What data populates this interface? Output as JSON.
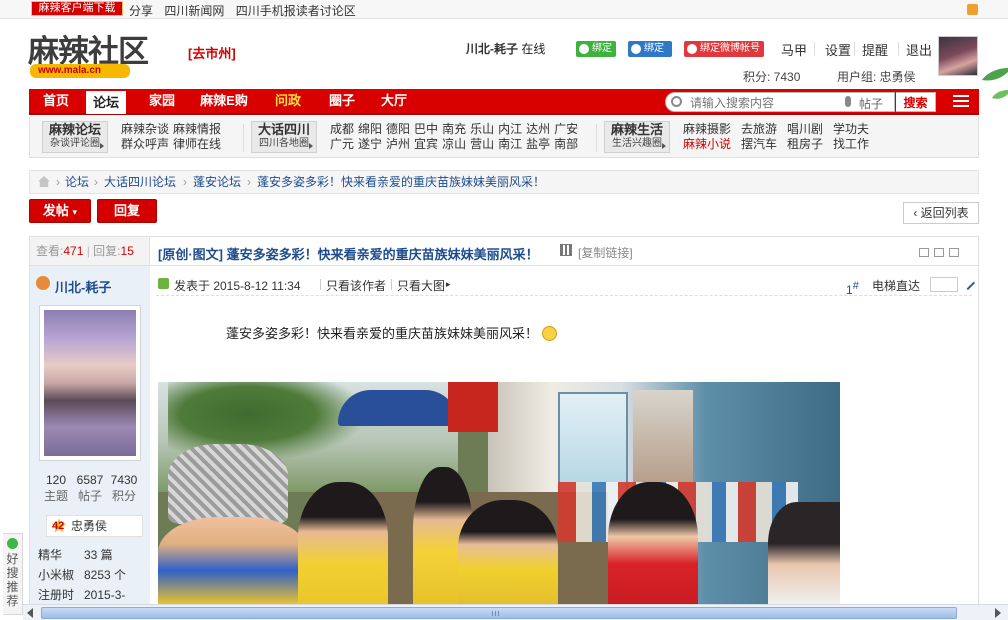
{
  "topbar": {
    "download_btn": "麻辣客户端下载",
    "links": [
      "分享",
      "四川新闻网",
      "四川手机报读者讨论区"
    ]
  },
  "header": {
    "logo_text": "麻辣社区",
    "logo_url": "www.mala.cn",
    "city": "[去市州]",
    "username": "川北-耗子",
    "online": "在线",
    "bind_wechat": "绑定",
    "bind_qq": "绑定",
    "bind_weibo": "绑定微博帐号",
    "menu": [
      "马甲",
      "设置",
      "提醒",
      "退出"
    ],
    "points_label": "积分: 7430",
    "group_label": "用户组: 忠勇侯"
  },
  "nav": {
    "items": [
      "首页",
      "论坛",
      "家园",
      "麻辣E购",
      "问政",
      "圈子",
      "大厅"
    ],
    "search_placeholder": "请输入搜索内容",
    "search_type": "帖子",
    "search_btn": "搜索"
  },
  "subnav": {
    "groups": [
      {
        "title": "麻辣论坛",
        "sub": "杂谈评论圈",
        "links": [
          [
            "麻辣杂谈",
            "麻辣情报"
          ],
          [
            "群众呼声",
            "律师在线"
          ]
        ]
      },
      {
        "title": "大话四川",
        "sub": "四川各地圈",
        "links": [
          [
            "成都",
            "绵阳",
            "德阳",
            "巴中",
            "南充",
            "乐山",
            "内江",
            "达州",
            "广安"
          ],
          [
            "广元",
            "遂宁",
            "泸州",
            "宜宾",
            "凉山",
            "营山",
            "南江",
            "盐亭",
            "南部"
          ]
        ]
      },
      {
        "title": "麻辣生活",
        "sub": "生活兴趣圈",
        "links": [
          [
            "麻辣摄影",
            "去旅游",
            "唱川剧",
            "学功夫"
          ],
          [
            "麻辣小说",
            "摆汽车",
            "租房子",
            "找工作"
          ]
        ]
      }
    ]
  },
  "breadcrumb": [
    "论坛",
    "大话四川论坛",
    "蓬安论坛",
    "蓬安多姿多彩！快来看亲爱的重庆苗族妹妹美丽风采！"
  ],
  "actions": {
    "post": "发帖",
    "reply": "回复",
    "back": "返回列表"
  },
  "thread": {
    "views_label": "查看:",
    "views": "471",
    "replies_label": "回复:",
    "replies": "15",
    "title": "[原创·图文] 蓬安多姿多彩！快来看亲爱的重庆苗族妹妹美丽风采！",
    "copy_link": "[复制链接]"
  },
  "author": {
    "name": "川北-耗子",
    "stats": [
      {
        "value": "120",
        "label": "主题"
      },
      {
        "value": "6587",
        "label": "帖子"
      },
      {
        "value": "7430",
        "label": "积分"
      }
    ],
    "level_num": "42",
    "level": "忠勇侯",
    "profile": [
      {
        "k": "精华",
        "v": "33 篇"
      },
      {
        "k": "小米椒",
        "v": "8253 个"
      },
      {
        "k": "注册时",
        "v": "2015-3-"
      }
    ]
  },
  "post": {
    "posted": "发表于 2015-8-12 11:34",
    "only_author": "只看该作者",
    "big_image": "只看大图",
    "floor": "1",
    "floor_sup": "#",
    "elevator": "电梯直达",
    "message": "蓬安多姿多彩！快来看亲爱的重庆苗族妹妹美丽风采！"
  },
  "sidetab": "好搜推荐"
}
